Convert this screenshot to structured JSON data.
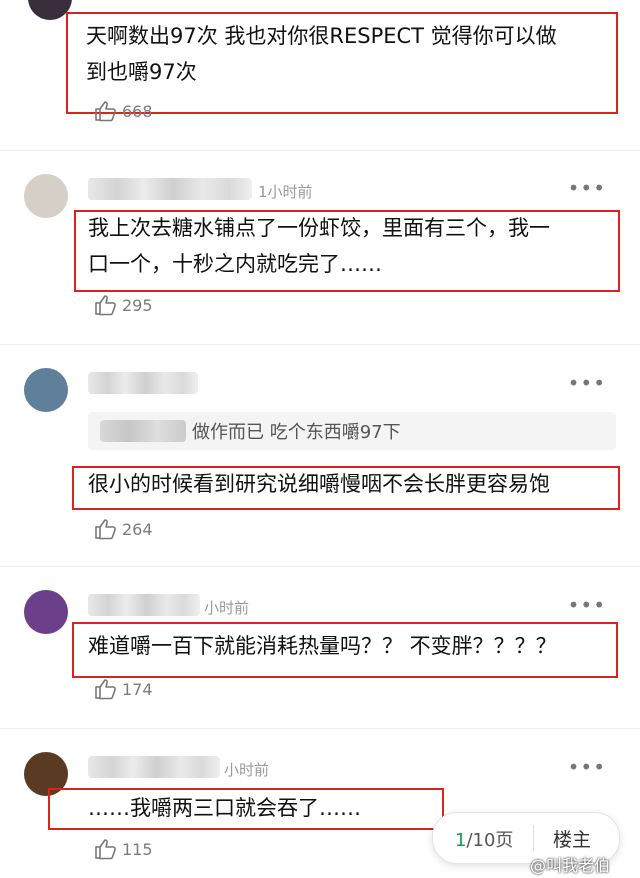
{
  "comments": [
    {
      "time": "",
      "text_lines": [
        "天啊数出97次 我也对你很RESPECT 觉得你可以做",
        "到也嚼97次"
      ],
      "likes": "668",
      "avatar_color": "#3a2d3c"
    },
    {
      "time": "1小时前",
      "text_lines": [
        "我上次去糖水铺点了一份虾饺，里面有三个，我一",
        "口一个，十秒之内就吃完了……"
      ],
      "likes": "295",
      "avatar_color": "#d6cfc8"
    },
    {
      "time": "",
      "quote_text": "做作而已  吃个东西嚼97下",
      "text_lines": [
        "很小的时候看到研究说细嚼慢咽不会长胖更容易饱"
      ],
      "likes": "264",
      "avatar_color": "#5f7f9a"
    },
    {
      "time": "小时前",
      "text_lines": [
        "难道嚼一百下就能消耗热量吗？？ 不变胖？？？？"
      ],
      "likes": "174",
      "avatar_color": "#6b3f8a"
    },
    {
      "time": "小时前",
      "text_lines": [
        "……我嚼两三口就会吞了……"
      ],
      "likes": "115",
      "avatar_color": "#5a3a22"
    }
  ],
  "more_icon": "more-dots-icon",
  "like_icon": "thumbs-up-icon",
  "pager": {
    "current": "1",
    "rest": "/10页",
    "floor_label": "楼主"
  },
  "watermark": "@叫我老伯",
  "highlight_color": "#d9231c"
}
